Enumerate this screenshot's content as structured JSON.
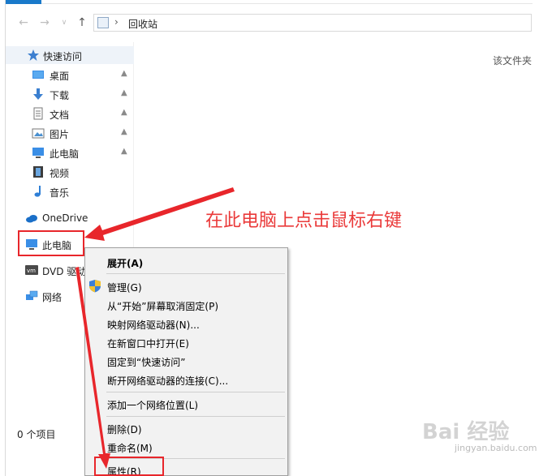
{
  "window": {
    "address_crumb": "回收站",
    "right_hint": "该文件夹"
  },
  "navpane": {
    "quick_access": "快速访问",
    "items": [
      {
        "label": "桌面",
        "icon": "desktop-icon",
        "pinned": true
      },
      {
        "label": "下载",
        "icon": "download-icon",
        "pinned": true
      },
      {
        "label": "文档",
        "icon": "document-icon",
        "pinned": true
      },
      {
        "label": "图片",
        "icon": "picture-icon",
        "pinned": true
      },
      {
        "label": "此电脑",
        "icon": "this-pc-icon",
        "pinned": true
      },
      {
        "label": "视频",
        "icon": "video-icon",
        "pinned": false
      },
      {
        "label": "音乐",
        "icon": "music-icon",
        "pinned": false
      }
    ],
    "onedrive": "OneDrive",
    "this_pc": "此电脑",
    "dvd": "DVD 驱动",
    "network": "网络"
  },
  "status": {
    "item_count": "0 个项目"
  },
  "context_menu": {
    "items": [
      {
        "label": "展开(A)",
        "bold": true
      },
      {
        "label": "管理(G)",
        "icon": "uac-shield-icon"
      },
      {
        "label": "从“开始”屏幕取消固定(P)"
      },
      {
        "label": "映射网络驱动器(N)..."
      },
      {
        "label": "在新窗口中打开(E)"
      },
      {
        "label": "固定到“快速访问”"
      },
      {
        "label": "断开网络驱动器的连接(C)..."
      },
      {
        "label": "添加一个网络位置(L)"
      },
      {
        "label": "删除(D)"
      },
      {
        "label": "重命名(M)"
      },
      {
        "label": "属性(R)"
      }
    ]
  },
  "annotation": {
    "text": "在此电脑上点击鼠标右键",
    "color": "#e8262b"
  },
  "watermark": {
    "text": "Bai 经验",
    "sub": "jingyan.baidu.com"
  }
}
